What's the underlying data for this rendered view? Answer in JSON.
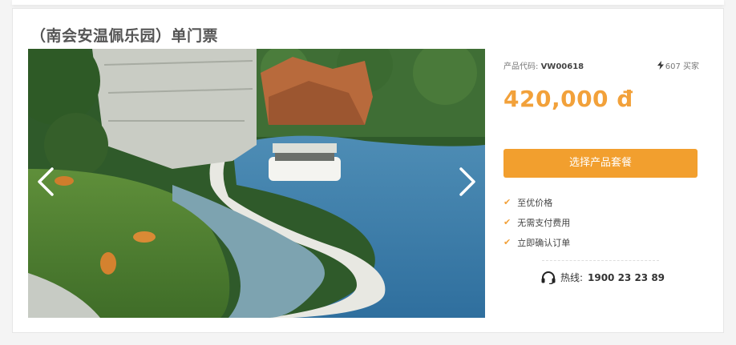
{
  "product": {
    "title": "（南会安温佩乐园）单门票",
    "code_label": "产品代码:",
    "code_value": "VW00618",
    "sold_count": "607 买家",
    "price": "420,000 đ",
    "select_button": "选择产品套餐",
    "features": [
      "至优价格",
      "无需支付费用",
      "立即确认订单"
    ],
    "hotline_label": "热线:",
    "hotline_number": "1900 23 23 89"
  },
  "colors": {
    "accent": "#f2a13a",
    "button": "#f29f2e"
  },
  "icons": [
    "chevron-left-icon",
    "chevron-right-icon",
    "lightning-icon",
    "check-icon",
    "headset-icon"
  ]
}
